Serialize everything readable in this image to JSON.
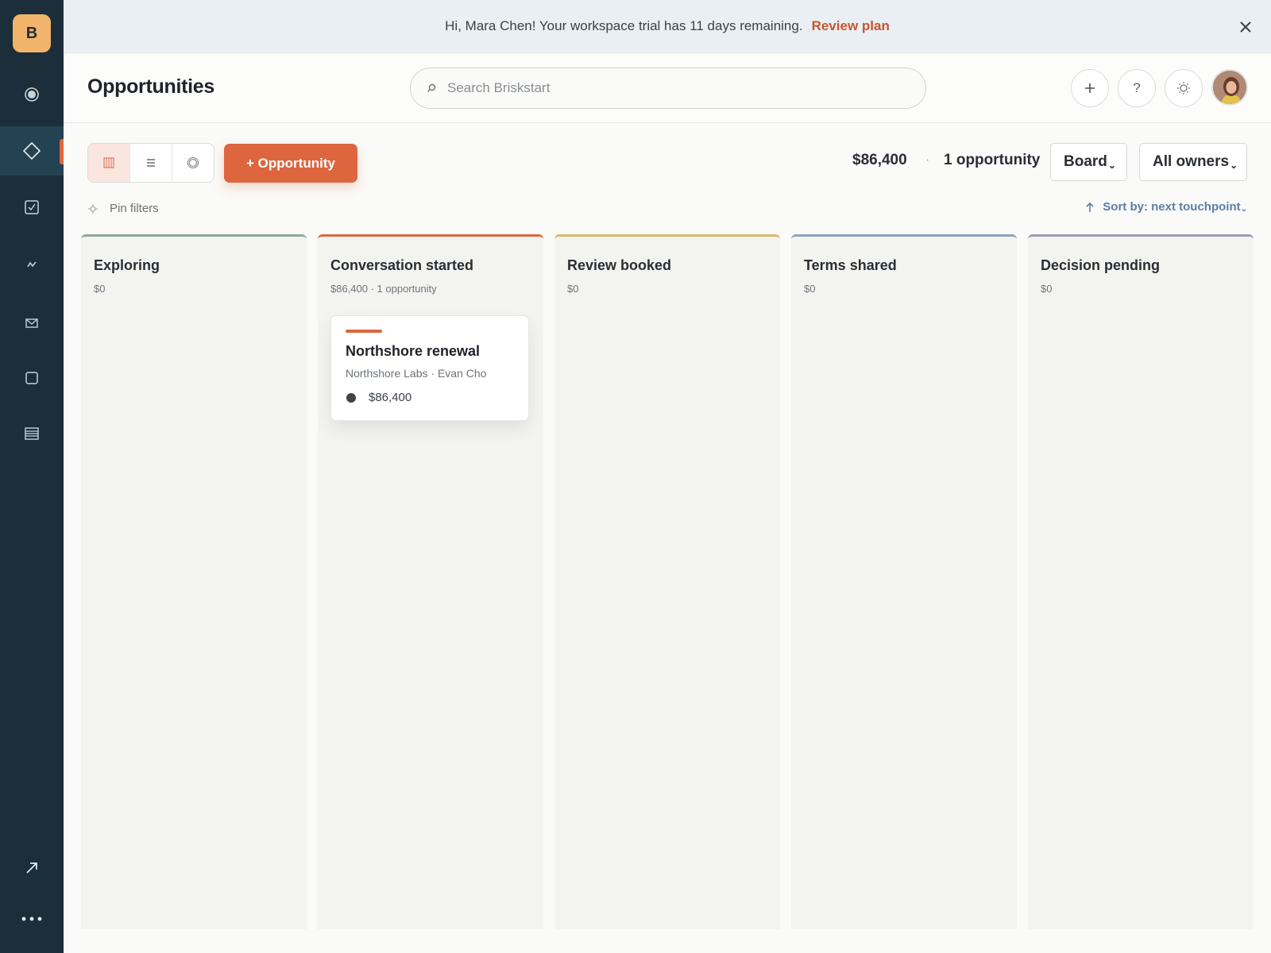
{
  "sidebar": {
    "logo": "B",
    "items": [
      {
        "icon": "home-icon"
      },
      {
        "icon": "opportunities-diamond-icon",
        "active": true
      },
      {
        "icon": "tasks-checkbox-icon"
      },
      {
        "icon": "activity-icon"
      },
      {
        "icon": "mail-icon"
      },
      {
        "icon": "square-icon"
      },
      {
        "icon": "reports-icon"
      },
      {
        "icon": "open-external-icon"
      },
      {
        "icon": "more-dots-icon"
      }
    ]
  },
  "banner": {
    "message": "Hi, Mara Chen! Your workspace trial has 11 days remaining.",
    "link": "Review plan"
  },
  "header": {
    "title": "Opportunities",
    "search_placeholder": "Search Briskstart"
  },
  "toolbar": {
    "add_label": "+ Opportunity",
    "total": "$86,400",
    "separator": "·",
    "count": "1 opportunity",
    "view_select": "Board",
    "owner_select": "All owners",
    "pin_filters": "Pin filters",
    "sort_label": "Sort by: next touchpoint"
  },
  "columns": [
    {
      "title": "Exploring",
      "sub": "$0",
      "color": "#8fa7a3"
    },
    {
      "title": "Conversation started",
      "sub": "$86,400 · 1 opportunity",
      "color": "#dd663f"
    },
    {
      "title": "Review booked",
      "sub": "$0",
      "color": "#d8b86a"
    },
    {
      "title": "Terms shared",
      "sub": "$0",
      "color": "#8aa3c0"
    },
    {
      "title": "Decision pending",
      "sub": "$0",
      "color": "#a09ab8"
    }
  ],
  "card": {
    "title": "Northshore renewal",
    "sub": "Northshore Labs · Evan Cho",
    "value": "$86,400"
  },
  "colors": {
    "sidebar_bg": "#1b2e3a",
    "accent": "#dd663f",
    "link": "#5b7fa6"
  }
}
